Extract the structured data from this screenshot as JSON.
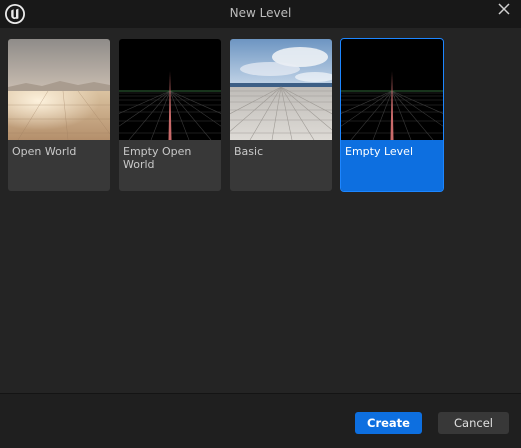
{
  "window": {
    "title": "New Level",
    "logo_icon": "unreal-engine-logo-icon",
    "close_icon": "close-icon"
  },
  "templates": [
    {
      "label": "Open World",
      "thumbnail": "desert-landscape",
      "selected": false
    },
    {
      "label": "Empty Open World",
      "thumbnail": "empty-grid",
      "selected": false
    },
    {
      "label": "Basic",
      "thumbnail": "tiled-floor-sky",
      "selected": false
    },
    {
      "label": "Empty Level",
      "thumbnail": "empty-grid",
      "selected": true
    }
  ],
  "footer": {
    "create_label": "Create",
    "cancel_label": "Cancel"
  },
  "colors": {
    "accent": "#0d6fe0",
    "background": "#242424",
    "titlebar": "#181818"
  }
}
